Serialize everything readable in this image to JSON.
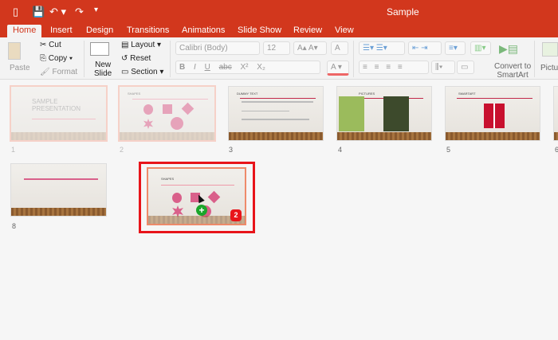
{
  "window": {
    "title": "Sample"
  },
  "quick_access": {
    "sidebar": "▯",
    "save": "💾",
    "undo": "↶ ▾",
    "redo": "↷",
    "customize": "▾"
  },
  "tabs": [
    {
      "label": "Home",
      "active": true
    },
    {
      "label": "Insert"
    },
    {
      "label": "Design"
    },
    {
      "label": "Transitions"
    },
    {
      "label": "Animations"
    },
    {
      "label": "Slide Show"
    },
    {
      "label": "Review"
    },
    {
      "label": "View"
    }
  ],
  "ribbon": {
    "paste": "Paste",
    "cut": "Cut",
    "copy": "Copy",
    "format": "Format",
    "new_slide_1": "New",
    "new_slide_2": "Slide",
    "layout": "Layout",
    "reset": "Reset",
    "section": "Section",
    "font": "Calibri (Body)",
    "size": "12",
    "bold": "B",
    "italic": "I",
    "underline": "U",
    "strike": "abc",
    "superscript": "X²",
    "subscript": "X₂",
    "convert_1": "Convert to",
    "convert_2": "SmartArt",
    "picture": "Picture"
  },
  "slides": [
    {
      "num": "1",
      "title": "SAMPLE PRESENTATION"
    },
    {
      "num": "2",
      "title": "SHAPES"
    },
    {
      "num": "3",
      "title": "DUMMY TEXT"
    },
    {
      "num": "4",
      "title": "PICTURES"
    },
    {
      "num": "5",
      "title": "SMARTART"
    },
    {
      "num": "6",
      "title": ""
    },
    {
      "num": "8",
      "title": ""
    }
  ],
  "drag": {
    "title": "SHAPES",
    "count": "2",
    "add_icon": "+"
  },
  "colors": {
    "accent": "#d2371d",
    "highlight": "#e8141a"
  }
}
